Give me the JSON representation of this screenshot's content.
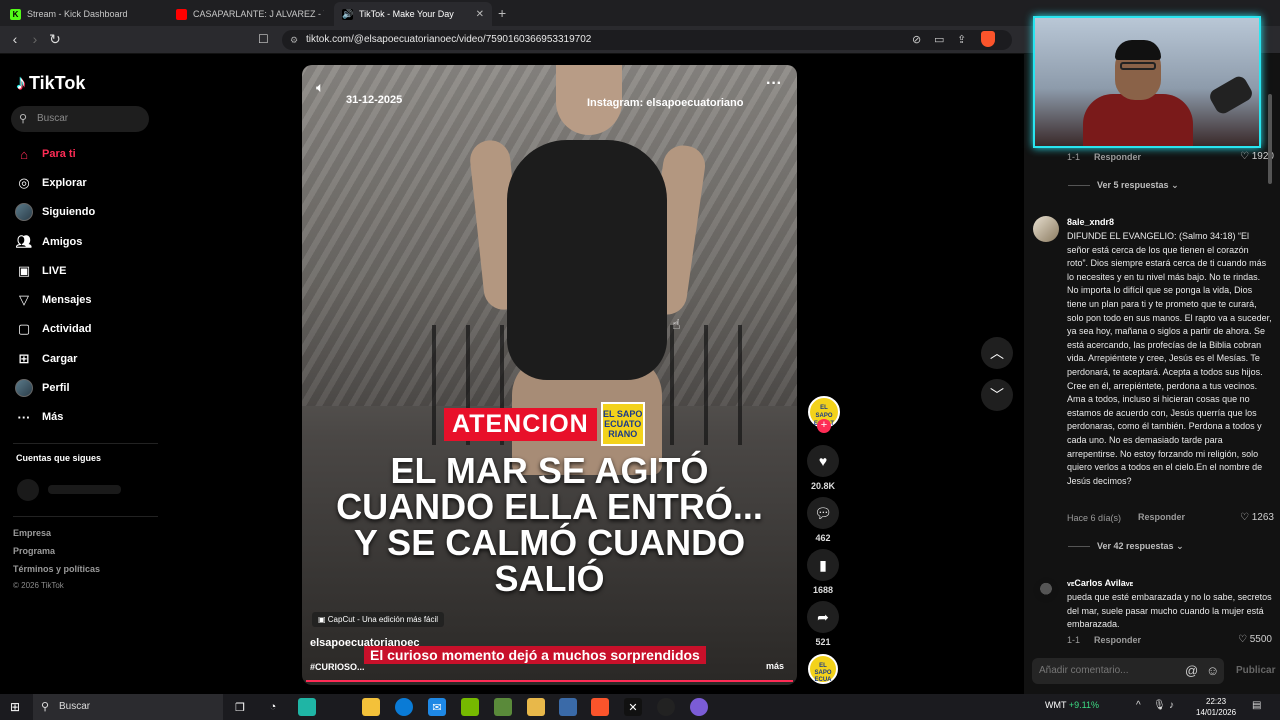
{
  "browser": {
    "tabs": [
      {
        "label": "Stream - Kick Dashboard",
        "color": "#53fc18"
      },
      {
        "label": "CASAPARLANTE: J ALVAREZ - YouTub",
        "color": "#ff0000"
      },
      {
        "label": "TikTok - Make Your Day",
        "color": "#ffffff",
        "active": true
      }
    ],
    "url": "tiktok.com/@elsapoecuatorianoec/video/7590160366953319702"
  },
  "sidebar": {
    "brand": "TikTok",
    "search_placeholder": "Buscar",
    "nav": [
      {
        "label": "Para ti",
        "icon": "home-icon"
      },
      {
        "label": "Explorar",
        "icon": "compass-icon"
      },
      {
        "label": "Siguiendo",
        "icon": "following-avatar-icon"
      },
      {
        "label": "Amigos",
        "icon": "friends-icon"
      },
      {
        "label": "LIVE",
        "icon": "live-icon"
      },
      {
        "label": "Mensajes",
        "icon": "messages-icon"
      },
      {
        "label": "Actividad",
        "icon": "activity-icon"
      },
      {
        "label": "Cargar",
        "icon": "upload-icon"
      },
      {
        "label": "Perfil",
        "icon": "profile-avatar-icon"
      },
      {
        "label": "Más",
        "icon": "more-icon"
      }
    ],
    "following_title": "Cuentas que sigues",
    "footer": [
      "Empresa",
      "Programa",
      "Términos y políticas"
    ],
    "copyright": "© 2026 TikTok"
  },
  "video": {
    "date": "31-12-2025",
    "instagram": "Instagram: elsapoecuatoriano",
    "badge": "ATENCION",
    "brand_box": "EL SAPO ECUATO RIANO",
    "headline": "EL MAR SE AGITÓ CUANDO ELLA ENTRÓ... Y SE CALMÓ CUANDO SALIÓ",
    "capcut": "CapCut - Una edición más fácil",
    "author": "elsapoecuatorianoec",
    "subtitle": "El curioso momento dejó a muchos sorprendidos",
    "tags": "#CURIOSO...",
    "more": "más"
  },
  "actions": {
    "likes": "20.8K",
    "comments": "462",
    "saves": "1688",
    "shares": "521"
  },
  "comments": {
    "c0": {
      "time": "1-1",
      "reply": "Responder",
      "likes": "1920"
    },
    "see_replies_1": "Ver 5 respuestas",
    "c1": {
      "user": "8ale_xndr8",
      "text": "DIFUNDE EL EVANGELIO: (Salmo 34:18) “El señor está cerca de los que tienen el corazón roto”. Dios siempre estará cerca de ti cuando más lo necesites y en tu nivel más bajo. No te rindas. No importa lo difícil que se ponga la vida, Dios tiene un plan para ti y te prometo que te curará, solo pon todo en sus manos. El rapto va a suceder, ya sea hoy, mañana o siglos a partir de ahora. Se está acercando, las profecías de la Biblia cobran vida. Arrepiéntete y cree, Jesús es el Mesías. Te perdonará, te aceptará. Acepta a todos sus hijos. Cree en él, arrepiéntete, perdona a tus vecinos. Ama a todos, incluso si hicieran cosas que no estamos de acuerdo con, Jesús querría que los perdonaras, como él también. Perdona a todos y cada uno. No es demasiado tarde para arrepentirse. No estoy forzando mi religión, solo quiero verlos a todos en el cielo.En el nombre de Jesús decimos?",
      "time": "Hace 6 día(s)",
      "reply": "Responder",
      "likes": "1263"
    },
    "see_replies_2": "Ver 42 respuestas",
    "c2": {
      "user_prefix": "ᴠᴇ",
      "user": "Carlos Avila",
      "user_suffix": "ᴠᴇ",
      "text": "pueda que esté embarazada y no lo sabe, secretos del mar, suele pasar mucho cuando la mujer está embarazada.",
      "time": "1-1",
      "reply": "Responder",
      "likes": "5500"
    },
    "input_placeholder": "Añadir comentario...",
    "post": "Publicar"
  },
  "taskbar": {
    "search": "Buscar",
    "stock_name": "WMT",
    "stock_change": "+9.11%",
    "time": "22:23",
    "date": "14/01/2026"
  },
  "colors": {
    "accent": "#fe2c55",
    "cam_border": "#29e5f0",
    "badge_red": "#e8102a",
    "brand_yellow": "#f3d21b"
  }
}
